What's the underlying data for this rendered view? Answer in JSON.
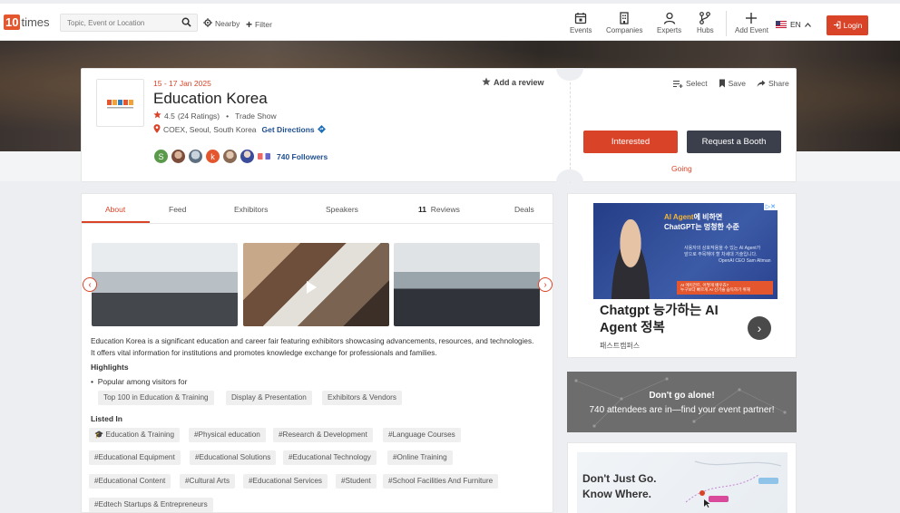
{
  "nav": {
    "logo_num": "10",
    "logo_text": "times",
    "search_placeholder": "Topic, Event or Location",
    "nearby": "Nearby",
    "filter": "Filter",
    "items": [
      {
        "label": "Events",
        "icon": "calendar-icon"
      },
      {
        "label": "Companies",
        "icon": "building-icon"
      },
      {
        "label": "Experts",
        "icon": "user-icon"
      },
      {
        "label": "Hubs",
        "icon": "hub-icon"
      }
    ],
    "add_event": "Add Event",
    "language": "EN",
    "login": "Login"
  },
  "event": {
    "date": "15 - 17 Jan 2025",
    "title": "Education Korea",
    "rating": "4.5",
    "ratings_count": "(24 Ratings)",
    "type": "Trade Show",
    "location": "COEX, Seoul, South Korea",
    "directions": "Get Directions",
    "followers": "740 Followers",
    "add_review": "Add a review",
    "actions": {
      "select": "Select",
      "save": "Save",
      "share": "Share"
    },
    "interested": "Interested",
    "request_booth": "Request a Booth",
    "going": "Going",
    "colors": {
      "accent": "#d94328",
      "dark_button": "#3b3f4b",
      "link": "#1f4f8f"
    }
  },
  "tabs": {
    "about": "About",
    "feed": "Feed",
    "exhibitors": "Exhibitors",
    "speakers": "Speakers",
    "reviews_count": "11",
    "reviews": "Reviews",
    "deals": "Deals"
  },
  "about": {
    "description": "Education Korea is a significant education and career fair featuring exhibitors showcasing advancements, resources, and technologies. It offers vital information for institutions and promotes knowledge exchange for professionals and families.",
    "highlights_heading": "Highlights",
    "popular_label": "Popular among visitors for",
    "highlight_chips": [
      "Top 100 in Education & Training",
      "Display & Presentation",
      "Exhibitors & Vendors"
    ],
    "listed_heading": "Listed In",
    "listed_chips": [
      "Education & Training",
      "#Physical education",
      "#Research & Development",
      "#Language Courses",
      "#Educational Equipment",
      "#Educational Solutions",
      "#Educational Technology",
      "#Online Training",
      "#Educational Content",
      "#Cultural Arts",
      "#Educational Services",
      "#Student",
      "#School Facilities And Furniture",
      "#Edtech Startups & Entrepreneurs"
    ]
  },
  "ad": {
    "headline_accent": "AI Agent",
    "headline_rest": "에 비하면",
    "headline_line2": "ChatGPT는 멍청한 수준",
    "small_line1": "사용자의 상호작용을 수 있는 AI Agent가",
    "small_line2": "앞으로 주목해야 할 차세대 기술입니다.",
    "caption": "OpenAI CEO Sam Altman",
    "bar_line1": "AI 에이전트, 어떻게 배우죠?",
    "bar_line2": "누구보다 빠르게 AI 신기술 습득하기 위해",
    "title_line1": "Chatgpt 능가하는 AI",
    "title_line2": "Agent 정복",
    "sponsor": "패스트캠퍼스"
  },
  "promo": {
    "title": "Don't go alone!",
    "subtitle": "740 attendees are in—find your event partner!"
  },
  "know": {
    "line1": "Don't Just Go.",
    "line2": "Know Where."
  }
}
